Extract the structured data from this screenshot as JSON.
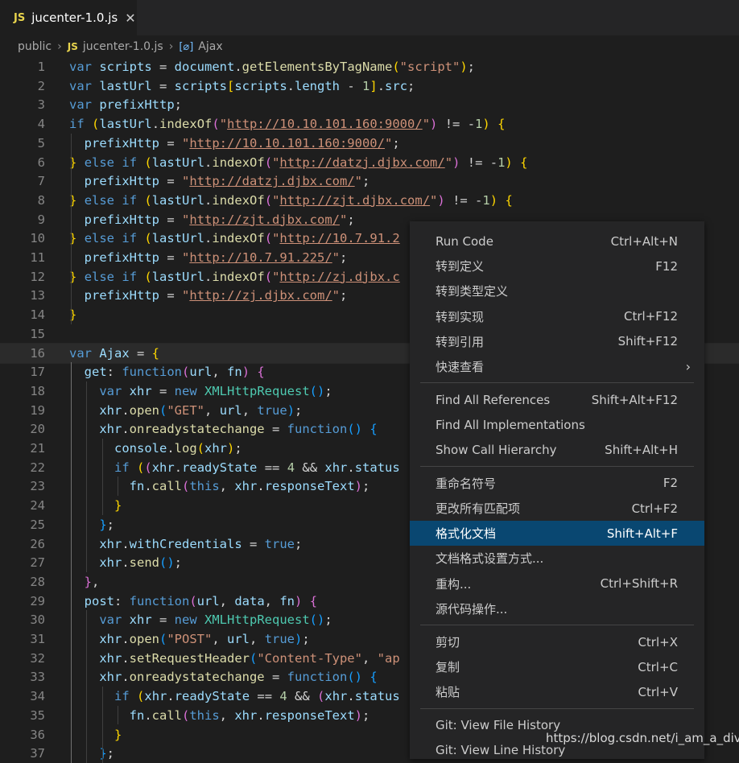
{
  "tab": {
    "lang": "JS",
    "title": "jucenter-1.0.js",
    "close": "✕"
  },
  "breadcrumbs": {
    "folder": "public",
    "lang": "JS",
    "file": "jucenter-1.0.js",
    "symbol_icon": "[⌀]",
    "symbol": "Ajax",
    "sep": "›"
  },
  "line_numbers": [
    "1",
    "2",
    "3",
    "4",
    "5",
    "6",
    "7",
    "8",
    "9",
    "10",
    "11",
    "12",
    "13",
    "14",
    "15",
    "16",
    "17",
    "18",
    "19",
    "20",
    "21",
    "22",
    "23",
    "24",
    "25",
    "26",
    "27",
    "28",
    "29",
    "30",
    "31",
    "32",
    "33",
    "34",
    "35",
    "36",
    "37"
  ],
  "code": [
    [
      [
        "kw",
        "var"
      ],
      [
        "pl",
        " "
      ],
      [
        "var",
        "scripts"
      ],
      [
        "pl",
        " = "
      ],
      [
        "var",
        "document"
      ],
      [
        "pl",
        "."
      ],
      [
        "fn",
        "getElementsByTagName"
      ],
      [
        "br1",
        "("
      ],
      [
        "str",
        "\"script\""
      ],
      [
        "br1",
        ")"
      ],
      [
        "pl",
        ";"
      ]
    ],
    [
      [
        "kw",
        "var"
      ],
      [
        "pl",
        " "
      ],
      [
        "var",
        "lastUrl"
      ],
      [
        "pl",
        " = "
      ],
      [
        "var",
        "scripts"
      ],
      [
        "br1",
        "["
      ],
      [
        "var",
        "scripts"
      ],
      [
        "pl",
        "."
      ],
      [
        "var",
        "length"
      ],
      [
        "pl",
        " - "
      ],
      [
        "num",
        "1"
      ],
      [
        "br1",
        "]"
      ],
      [
        "pl",
        "."
      ],
      [
        "var",
        "src"
      ],
      [
        "pl",
        ";"
      ]
    ],
    [
      [
        "kw",
        "var"
      ],
      [
        "pl",
        " "
      ],
      [
        "var",
        "prefixHttp"
      ],
      [
        "pl",
        ";"
      ]
    ],
    [
      [
        "kw",
        "if"
      ],
      [
        "pl",
        " "
      ],
      [
        "br1",
        "("
      ],
      [
        "var",
        "lastUrl"
      ],
      [
        "pl",
        "."
      ],
      [
        "fn",
        "indexOf"
      ],
      [
        "br2",
        "("
      ],
      [
        "str",
        "\""
      ],
      [
        "url",
        "http://10.10.101.160:9000/"
      ],
      [
        "str",
        "\""
      ],
      [
        "br2",
        ")"
      ],
      [
        "pl",
        " != -"
      ],
      [
        "num",
        "1"
      ],
      [
        "br1",
        ")"
      ],
      [
        "pl",
        " "
      ],
      [
        "br1",
        "{"
      ]
    ],
    [
      [
        "pl",
        "  "
      ],
      [
        "var",
        "prefixHttp"
      ],
      [
        "pl",
        " = "
      ],
      [
        "str",
        "\""
      ],
      [
        "url",
        "http://10.10.101.160:9000/"
      ],
      [
        "str",
        "\""
      ],
      [
        "pl",
        ";"
      ]
    ],
    [
      [
        "br1",
        "}"
      ],
      [
        "pl",
        " "
      ],
      [
        "kw",
        "else"
      ],
      [
        "pl",
        " "
      ],
      [
        "kw",
        "if"
      ],
      [
        "pl",
        " "
      ],
      [
        "br1",
        "("
      ],
      [
        "var",
        "lastUrl"
      ],
      [
        "pl",
        "."
      ],
      [
        "fn",
        "indexOf"
      ],
      [
        "br2",
        "("
      ],
      [
        "str",
        "\""
      ],
      [
        "url",
        "http://datzj.djbx.com/"
      ],
      [
        "str",
        "\""
      ],
      [
        "br2",
        ")"
      ],
      [
        "pl",
        " != -"
      ],
      [
        "num",
        "1"
      ],
      [
        "br1",
        ")"
      ],
      [
        "pl",
        " "
      ],
      [
        "br1",
        "{"
      ]
    ],
    [
      [
        "pl",
        "  "
      ],
      [
        "var",
        "prefixHttp"
      ],
      [
        "pl",
        " = "
      ],
      [
        "str",
        "\""
      ],
      [
        "url",
        "http://datzj.djbx.com/"
      ],
      [
        "str",
        "\""
      ],
      [
        "pl",
        ";"
      ]
    ],
    [
      [
        "br1",
        "}"
      ],
      [
        "pl",
        " "
      ],
      [
        "kw",
        "else"
      ],
      [
        "pl",
        " "
      ],
      [
        "kw",
        "if"
      ],
      [
        "pl",
        " "
      ],
      [
        "br1",
        "("
      ],
      [
        "var",
        "lastUrl"
      ],
      [
        "pl",
        "."
      ],
      [
        "fn",
        "indexOf"
      ],
      [
        "br2",
        "("
      ],
      [
        "str",
        "\""
      ],
      [
        "url",
        "http://zjt.djbx.com/"
      ],
      [
        "str",
        "\""
      ],
      [
        "br2",
        ")"
      ],
      [
        "pl",
        " != -"
      ],
      [
        "num",
        "1"
      ],
      [
        "br1",
        ")"
      ],
      [
        "pl",
        " "
      ],
      [
        "br1",
        "{"
      ]
    ],
    [
      [
        "pl",
        "  "
      ],
      [
        "var",
        "prefixHttp"
      ],
      [
        "pl",
        " = "
      ],
      [
        "str",
        "\""
      ],
      [
        "url",
        "http://zjt.djbx.com/"
      ],
      [
        "str",
        "\""
      ],
      [
        "pl",
        ";"
      ]
    ],
    [
      [
        "br1",
        "}"
      ],
      [
        "pl",
        " "
      ],
      [
        "kw",
        "else"
      ],
      [
        "pl",
        " "
      ],
      [
        "kw",
        "if"
      ],
      [
        "pl",
        " "
      ],
      [
        "br1",
        "("
      ],
      [
        "var",
        "lastUrl"
      ],
      [
        "pl",
        "."
      ],
      [
        "fn",
        "indexOf"
      ],
      [
        "br2",
        "("
      ],
      [
        "str",
        "\""
      ],
      [
        "url",
        "http://10.7.91.2"
      ]
    ],
    [
      [
        "pl",
        "  "
      ],
      [
        "var",
        "prefixHttp"
      ],
      [
        "pl",
        " = "
      ],
      [
        "str",
        "\""
      ],
      [
        "url",
        "http://10.7.91.225/"
      ],
      [
        "str",
        "\""
      ],
      [
        "pl",
        ";"
      ]
    ],
    [
      [
        "br1",
        "}"
      ],
      [
        "pl",
        " "
      ],
      [
        "kw",
        "else"
      ],
      [
        "pl",
        " "
      ],
      [
        "kw",
        "if"
      ],
      [
        "pl",
        " "
      ],
      [
        "br1",
        "("
      ],
      [
        "var",
        "lastUrl"
      ],
      [
        "pl",
        "."
      ],
      [
        "fn",
        "indexOf"
      ],
      [
        "br2",
        "("
      ],
      [
        "str",
        "\""
      ],
      [
        "url",
        "http://zj.djbx.c"
      ]
    ],
    [
      [
        "pl",
        "  "
      ],
      [
        "var",
        "prefixHttp"
      ],
      [
        "pl",
        " = "
      ],
      [
        "str",
        "\""
      ],
      [
        "url",
        "http://zj.djbx.com/"
      ],
      [
        "str",
        "\""
      ],
      [
        "pl",
        ";"
      ]
    ],
    [
      [
        "br1",
        "}"
      ]
    ],
    [],
    [
      [
        "kw",
        "var"
      ],
      [
        "pl",
        " "
      ],
      [
        "var",
        "Ajax"
      ],
      [
        "pl",
        " = "
      ],
      [
        "br1",
        "{"
      ]
    ],
    [
      [
        "pl",
        "  "
      ],
      [
        "var",
        "get"
      ],
      [
        "pl",
        ": "
      ],
      [
        "kw",
        "function"
      ],
      [
        "br2",
        "("
      ],
      [
        "var",
        "url"
      ],
      [
        "pl",
        ", "
      ],
      [
        "var",
        "fn"
      ],
      [
        "br2",
        ")"
      ],
      [
        "pl",
        " "
      ],
      [
        "br2",
        "{"
      ]
    ],
    [
      [
        "pl",
        "    "
      ],
      [
        "kw",
        "var"
      ],
      [
        "pl",
        " "
      ],
      [
        "var",
        "xhr"
      ],
      [
        "pl",
        " = "
      ],
      [
        "kw",
        "new"
      ],
      [
        "pl",
        " "
      ],
      [
        "cls",
        "XMLHttpRequest"
      ],
      [
        "br3",
        "()"
      ],
      [
        "pl",
        ";"
      ]
    ],
    [
      [
        "pl",
        "    "
      ],
      [
        "var",
        "xhr"
      ],
      [
        "pl",
        "."
      ],
      [
        "fn",
        "open"
      ],
      [
        "br3",
        "("
      ],
      [
        "str",
        "\"GET\""
      ],
      [
        "pl",
        ", "
      ],
      [
        "var",
        "url"
      ],
      [
        "pl",
        ", "
      ],
      [
        "kw",
        "true"
      ],
      [
        "br3",
        ")"
      ],
      [
        "pl",
        ";"
      ]
    ],
    [
      [
        "pl",
        "    "
      ],
      [
        "var",
        "xhr"
      ],
      [
        "pl",
        "."
      ],
      [
        "fn",
        "onreadystatechange"
      ],
      [
        "pl",
        " = "
      ],
      [
        "kw",
        "function"
      ],
      [
        "br3",
        "()"
      ],
      [
        "pl",
        " "
      ],
      [
        "br3",
        "{"
      ]
    ],
    [
      [
        "pl",
        "      "
      ],
      [
        "var",
        "console"
      ],
      [
        "pl",
        "."
      ],
      [
        "fn",
        "log"
      ],
      [
        "br1",
        "("
      ],
      [
        "var",
        "xhr"
      ],
      [
        "br1",
        ")"
      ],
      [
        "pl",
        ";"
      ]
    ],
    [
      [
        "pl",
        "      "
      ],
      [
        "kw",
        "if"
      ],
      [
        "pl",
        " "
      ],
      [
        "br1",
        "("
      ],
      [
        "br2",
        "("
      ],
      [
        "var",
        "xhr"
      ],
      [
        "pl",
        "."
      ],
      [
        "var",
        "readyState"
      ],
      [
        "pl",
        " == "
      ],
      [
        "num",
        "4"
      ],
      [
        "pl",
        " && "
      ],
      [
        "var",
        "xhr"
      ],
      [
        "pl",
        "."
      ],
      [
        "var",
        "status"
      ]
    ],
    [
      [
        "pl",
        "        "
      ],
      [
        "var",
        "fn"
      ],
      [
        "pl",
        "."
      ],
      [
        "fn",
        "call"
      ],
      [
        "br2",
        "("
      ],
      [
        "kw",
        "this"
      ],
      [
        "pl",
        ", "
      ],
      [
        "var",
        "xhr"
      ],
      [
        "pl",
        "."
      ],
      [
        "var",
        "responseText"
      ],
      [
        "br2",
        ")"
      ],
      [
        "pl",
        ";"
      ]
    ],
    [
      [
        "pl",
        "      "
      ],
      [
        "br1",
        "}"
      ]
    ],
    [
      [
        "pl",
        "    "
      ],
      [
        "br3",
        "}"
      ],
      [
        "pl",
        ";"
      ]
    ],
    [
      [
        "pl",
        "    "
      ],
      [
        "var",
        "xhr"
      ],
      [
        "pl",
        "."
      ],
      [
        "var",
        "withCredentials"
      ],
      [
        "pl",
        " = "
      ],
      [
        "kw",
        "true"
      ],
      [
        "pl",
        ";"
      ]
    ],
    [
      [
        "pl",
        "    "
      ],
      [
        "var",
        "xhr"
      ],
      [
        "pl",
        "."
      ],
      [
        "fn",
        "send"
      ],
      [
        "br3",
        "()"
      ],
      [
        "pl",
        ";"
      ]
    ],
    [
      [
        "pl",
        "  "
      ],
      [
        "br2",
        "}"
      ],
      [
        "pl",
        ","
      ]
    ],
    [
      [
        "pl",
        "  "
      ],
      [
        "var",
        "post"
      ],
      [
        "pl",
        ": "
      ],
      [
        "kw",
        "function"
      ],
      [
        "br2",
        "("
      ],
      [
        "var",
        "url"
      ],
      [
        "pl",
        ", "
      ],
      [
        "var",
        "data"
      ],
      [
        "pl",
        ", "
      ],
      [
        "var",
        "fn"
      ],
      [
        "br2",
        ")"
      ],
      [
        "pl",
        " "
      ],
      [
        "br2",
        "{"
      ]
    ],
    [
      [
        "pl",
        "    "
      ],
      [
        "kw",
        "var"
      ],
      [
        "pl",
        " "
      ],
      [
        "var",
        "xhr"
      ],
      [
        "pl",
        " = "
      ],
      [
        "kw",
        "new"
      ],
      [
        "pl",
        " "
      ],
      [
        "cls",
        "XMLHttpRequest"
      ],
      [
        "br3",
        "()"
      ],
      [
        "pl",
        ";"
      ]
    ],
    [
      [
        "pl",
        "    "
      ],
      [
        "var",
        "xhr"
      ],
      [
        "pl",
        "."
      ],
      [
        "fn",
        "open"
      ],
      [
        "br3",
        "("
      ],
      [
        "str",
        "\"POST\""
      ],
      [
        "pl",
        ", "
      ],
      [
        "var",
        "url"
      ],
      [
        "pl",
        ", "
      ],
      [
        "kw",
        "true"
      ],
      [
        "br3",
        ")"
      ],
      [
        "pl",
        ";"
      ]
    ],
    [
      [
        "pl",
        "    "
      ],
      [
        "var",
        "xhr"
      ],
      [
        "pl",
        "."
      ],
      [
        "fn",
        "setRequestHeader"
      ],
      [
        "br3",
        "("
      ],
      [
        "str",
        "\"Content-Type\""
      ],
      [
        "pl",
        ", "
      ],
      [
        "str",
        "\"ap"
      ]
    ],
    [
      [
        "pl",
        "    "
      ],
      [
        "var",
        "xhr"
      ],
      [
        "pl",
        "."
      ],
      [
        "fn",
        "onreadystatechange"
      ],
      [
        "pl",
        " = "
      ],
      [
        "kw",
        "function"
      ],
      [
        "br3",
        "()"
      ],
      [
        "pl",
        " "
      ],
      [
        "br3",
        "{"
      ]
    ],
    [
      [
        "pl",
        "      "
      ],
      [
        "kw",
        "if"
      ],
      [
        "pl",
        " "
      ],
      [
        "br1",
        "("
      ],
      [
        "var",
        "xhr"
      ],
      [
        "pl",
        "."
      ],
      [
        "var",
        "readyState"
      ],
      [
        "pl",
        " == "
      ],
      [
        "num",
        "4"
      ],
      [
        "pl",
        " && "
      ],
      [
        "br2",
        "("
      ],
      [
        "var",
        "xhr"
      ],
      [
        "pl",
        "."
      ],
      [
        "var",
        "status"
      ]
    ],
    [
      [
        "pl",
        "        "
      ],
      [
        "var",
        "fn"
      ],
      [
        "pl",
        "."
      ],
      [
        "fn",
        "call"
      ],
      [
        "br2",
        "("
      ],
      [
        "kw",
        "this"
      ],
      [
        "pl",
        ", "
      ],
      [
        "var",
        "xhr"
      ],
      [
        "pl",
        "."
      ],
      [
        "var",
        "responseText"
      ],
      [
        "br2",
        ")"
      ],
      [
        "pl",
        ";"
      ]
    ],
    [
      [
        "pl",
        "      "
      ],
      [
        "br1",
        "}"
      ]
    ],
    [
      [
        "pl",
        "    "
      ],
      [
        "br3",
        "}"
      ],
      [
        "pl",
        ";"
      ]
    ]
  ],
  "menu": {
    "groups": [
      [
        {
          "label": "Run Code",
          "key": "Ctrl+Alt+N"
        },
        {
          "label": "转到定义",
          "key": "F12"
        },
        {
          "label": "转到类型定义",
          "key": ""
        },
        {
          "label": "转到实现",
          "key": "Ctrl+F12"
        },
        {
          "label": "转到引用",
          "key": "Shift+F12"
        },
        {
          "label": "快速查看",
          "key": "",
          "submenu": "›"
        }
      ],
      [
        {
          "label": "Find All References",
          "key": "Shift+Alt+F12"
        },
        {
          "label": "Find All Implementations",
          "key": ""
        },
        {
          "label": "Show Call Hierarchy",
          "key": "Shift+Alt+H"
        }
      ],
      [
        {
          "label": "重命名符号",
          "key": "F2"
        },
        {
          "label": "更改所有匹配项",
          "key": "Ctrl+F2"
        },
        {
          "label": "格式化文档",
          "key": "Shift+Alt+F",
          "active": true
        },
        {
          "label": "文档格式设置方式...",
          "key": ""
        },
        {
          "label": "重构...",
          "key": "Ctrl+Shift+R"
        },
        {
          "label": "源代码操作...",
          "key": ""
        }
      ],
      [
        {
          "label": "剪切",
          "key": "Ctrl+X"
        },
        {
          "label": "复制",
          "key": "Ctrl+C"
        },
        {
          "label": "粘贴",
          "key": "Ctrl+V"
        }
      ],
      [
        {
          "label": "Git: View File History",
          "key": ""
        },
        {
          "label": "Git: View Line History",
          "key": ""
        }
      ]
    ]
  },
  "watermark": "https://blog.csdn.net/i_am_a_div"
}
